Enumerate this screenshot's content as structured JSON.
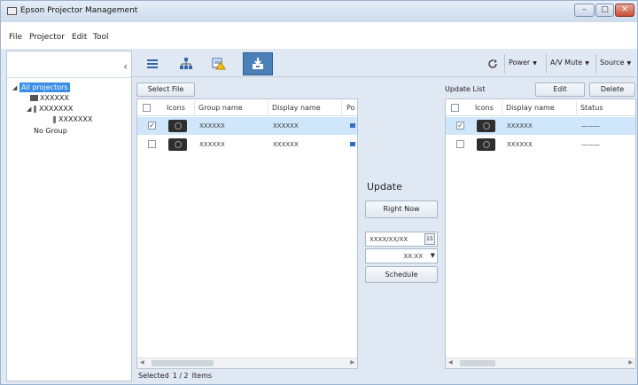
{
  "app": {
    "title": "Epson Projector Management"
  },
  "menu": [
    "File",
    "Projector",
    "Edit",
    "Tool"
  ],
  "tree": {
    "items": [
      {
        "label": "All projectors",
        "selected": true
      },
      {
        "label": "XXXXXX"
      },
      {
        "label": "XXXXXXX"
      },
      {
        "label": "XXXXXXX"
      },
      {
        "label": "No Group"
      }
    ]
  },
  "toolbar": {
    "power": "Power",
    "av_mute": "A/V Mute",
    "source": "Source"
  },
  "left_list": {
    "select_file": "Select File",
    "columns": [
      "Icons",
      "Group name",
      "Display name",
      "Po"
    ],
    "rows": [
      {
        "checked": true,
        "group": "XXXXXX",
        "display": "XXXXXX",
        "selected": true
      },
      {
        "checked": false,
        "group": "XXXXXX",
        "display": "XXXXXX",
        "selected": false
      }
    ]
  },
  "update": {
    "heading": "Update",
    "right_now": "Right Now",
    "date": "XXXX/XX/XX",
    "time": "XX:XX",
    "schedule": "Schedule"
  },
  "update_list": {
    "title": "Update List",
    "edit": "Edit",
    "delete": "Delete",
    "columns": [
      "Icons",
      "Display name",
      "Status"
    ],
    "rows": [
      {
        "checked": true,
        "display": "XXXXXX",
        "status": "———",
        "selected": true
      },
      {
        "checked": false,
        "display": "XXXXXX",
        "status": "———",
        "selected": false
      }
    ]
  },
  "status_bar": {
    "selected": "Selected",
    "count": "1 / 2",
    "items": "Items"
  },
  "colors": {
    "accent": "#3a8ee6",
    "tab_active": "#4a80b8",
    "row_selected": "#cfe6fb"
  }
}
